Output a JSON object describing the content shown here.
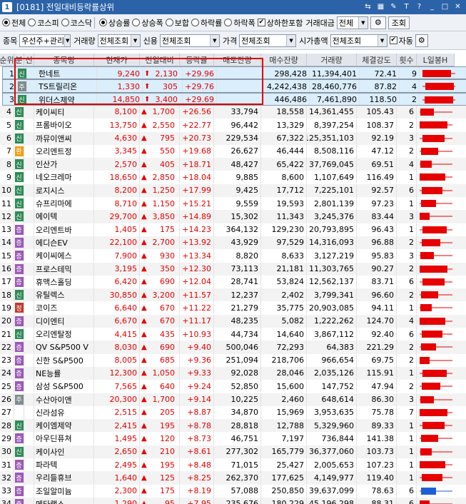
{
  "window": {
    "screen_no": "[0181]",
    "title": "전일대비등락률상위",
    "badge": "1"
  },
  "market_radios": [
    {
      "label": "전체",
      "checked": true
    },
    {
      "label": "코스피",
      "checked": false
    },
    {
      "label": "코스닥",
      "checked": false
    }
  ],
  "sort_radios": [
    {
      "label": "상승률",
      "checked": true
    },
    {
      "label": "상승폭",
      "checked": false
    },
    {
      "label": "보합",
      "checked": false
    },
    {
      "label": "하락률",
      "checked": false
    },
    {
      "label": "하락폭",
      "checked": false
    }
  ],
  "limit_include": {
    "label": "상하한포함",
    "checked": true
  },
  "volume_label": "거래대금",
  "volume_value": "전체",
  "search_label": "조회",
  "filters": {
    "stock_label": "종목",
    "stock_value": "우선주+관리",
    "volume_label": "거래량",
    "volume_value": "전체조회",
    "credit_label": "신용",
    "credit_value": "전체조회",
    "price_label": "가격",
    "price_value": "전체조회",
    "cap_label": "시가총액",
    "cap_value": "전체조회",
    "auto_label": "자동",
    "auto_checked": true
  },
  "columns": [
    "순위",
    "분",
    "신",
    "종목명",
    "현재가",
    "전일대비",
    "등락률",
    "매도잔량",
    "매수잔량",
    "거래량",
    "체결강도",
    "횟수",
    "L일봉H"
  ],
  "badge_colors": {
    "신": "#2e8b57",
    "증": "#9b59b6",
    "환": "#f39c12",
    "주": "#7f8c8d",
    "정": "#c0392b"
  },
  "rows": [
    {
      "rank": "1",
      "b1": "신",
      "b2": "",
      "name": "한네트",
      "price": "9,240",
      "chg": "2,130",
      "rate": "+29.96",
      "sell": "",
      "buy": "298,428",
      "vol": "11,394,401",
      "str": "72.41",
      "cnt": "9",
      "up": "limit"
    },
    {
      "rank": "2",
      "b1": "주",
      "b2": "",
      "name": "TS트릴리온",
      "price": "1,330",
      "chg": "305",
      "rate": "+29.76",
      "sell": "",
      "buy": "4,242,438",
      "vol": "28,460,776",
      "str": "87.82",
      "cnt": "4",
      "up": "limit"
    },
    {
      "rank": "3",
      "b1": "신",
      "b2": "",
      "name": "위더스제약",
      "price": "14,850",
      "chg": "3,400",
      "rate": "+29.69",
      "sell": "",
      "buy": "446,486",
      "vol": "7,461,890",
      "str": "118.50",
      "cnt": "2",
      "up": "limit"
    },
    {
      "rank": "4",
      "b1": "신",
      "b2": "",
      "name": "케이씨티",
      "price": "8,100",
      "chg": "1,700",
      "rate": "+26.56",
      "sell": "33,794",
      "buy": "18,558",
      "vol": "14,361,455",
      "str": "105.43",
      "cnt": "6",
      "up": "up"
    },
    {
      "rank": "5",
      "b1": "신",
      "b2": "",
      "name": "프롬바이오",
      "price": "13,750",
      "chg": "2,550",
      "rate": "+22.77",
      "sell": "96,442",
      "buy": "13,329",
      "vol": "8,397,254",
      "str": "108.37",
      "cnt": "2",
      "up": "up"
    },
    {
      "rank": "6",
      "b1": "신",
      "b2": "",
      "name": "까뮤이앤씨",
      "price": "4,630",
      "chg": "795",
      "rate": "+20.73",
      "sell": "229,534",
      "buy": "67,322",
      "vol": "125,351,103",
      "str": "92.19",
      "cnt": "3",
      "up": "up"
    },
    {
      "rank": "7",
      "b1": "환",
      "b2": "",
      "name": "오리엔트정",
      "price": "3,345",
      "chg": "550",
      "rate": "+19.68",
      "sell": "26,627",
      "buy": "46,444",
      "vol": "8,508,116",
      "str": "47.12",
      "cnt": "2",
      "up": "up"
    },
    {
      "rank": "8",
      "b1": "신",
      "b2": "",
      "name": "인산가",
      "price": "2,570",
      "chg": "405",
      "rate": "+18.71",
      "sell": "48,427",
      "buy": "65,422",
      "vol": "37,769,045",
      "str": "69.51",
      "cnt": "4",
      "up": "up"
    },
    {
      "rank": "9",
      "b1": "신",
      "b2": "",
      "name": "네오크레마",
      "price": "18,650",
      "chg": "2,850",
      "rate": "+18.04",
      "sell": "9,885",
      "buy": "8,600",
      "vol": "1,107,649",
      "str": "116.49",
      "cnt": "1",
      "up": "up"
    },
    {
      "rank": "10",
      "b1": "신",
      "b2": "",
      "name": "로지시스",
      "price": "8,200",
      "chg": "1,250",
      "rate": "+17.99",
      "sell": "9,425",
      "buy": "17,712",
      "vol": "7,225,101",
      "str": "92.57",
      "cnt": "6",
      "up": "up"
    },
    {
      "rank": "11",
      "b1": "신",
      "b2": "",
      "name": "슈프리마에",
      "price": "8,710",
      "chg": "1,150",
      "rate": "+15.21",
      "sell": "9,559",
      "buy": "19,593",
      "vol": "2,801,139",
      "str": "97.23",
      "cnt": "1",
      "up": "up"
    },
    {
      "rank": "12",
      "b1": "신",
      "b2": "",
      "name": "에이텍",
      "price": "29,700",
      "chg": "3,850",
      "rate": "+14.89",
      "sell": "15,302",
      "buy": "11,343",
      "vol": "3,245,376",
      "str": "83.44",
      "cnt": "3",
      "up": "up"
    },
    {
      "rank": "13",
      "b1": "증",
      "b2": "",
      "name": "오리엔트바",
      "price": "1,405",
      "chg": "175",
      "rate": "+14.23",
      "sell": "364,132",
      "buy": "129,230",
      "vol": "20,793,895",
      "str": "96.43",
      "cnt": "1",
      "up": "up"
    },
    {
      "rank": "14",
      "b1": "증",
      "b2": "",
      "name": "에디슨EV",
      "price": "22,100",
      "chg": "2,700",
      "rate": "+13.92",
      "sell": "43,929",
      "buy": "97,529",
      "vol": "14,316,093",
      "str": "96.88",
      "cnt": "2",
      "up": "up"
    },
    {
      "rank": "15",
      "b1": "증",
      "b2": "",
      "name": "케이씨에스",
      "price": "7,900",
      "chg": "930",
      "rate": "+13.34",
      "sell": "8,820",
      "buy": "8,633",
      "vol": "3,127,219",
      "str": "95.83",
      "cnt": "3",
      "up": "up"
    },
    {
      "rank": "16",
      "b1": "증",
      "b2": "",
      "name": "프로스테믹",
      "price": "3,195",
      "chg": "350",
      "rate": "+12.30",
      "sell": "73,113",
      "buy": "21,181",
      "vol": "11,303,765",
      "str": "90.27",
      "cnt": "2",
      "up": "up"
    },
    {
      "rank": "17",
      "b1": "증",
      "b2": "",
      "name": "휴맥스홀딩",
      "price": "6,420",
      "chg": "690",
      "rate": "+12.04",
      "sell": "28,741",
      "buy": "53,824",
      "vol": "12,562,137",
      "str": "83.71",
      "cnt": "6",
      "up": "up"
    },
    {
      "rank": "18",
      "b1": "신",
      "b2": "",
      "name": "유틸렉스",
      "price": "30,850",
      "chg": "3,200",
      "rate": "+11.57",
      "sell": "12,237",
      "buy": "2,402",
      "vol": "3,799,341",
      "str": "96.60",
      "cnt": "2",
      "up": "up"
    },
    {
      "rank": "19",
      "b1": "정",
      "b2": "",
      "name": "코이즈",
      "price": "6,640",
      "chg": "670",
      "rate": "+11.22",
      "sell": "21,279",
      "buy": "35,775",
      "vol": "20,903,085",
      "str": "94.11",
      "cnt": "1",
      "up": "up"
    },
    {
      "rank": "20",
      "b1": "증",
      "b2": "",
      "name": "디이엔티",
      "price": "6,670",
      "chg": "670",
      "rate": "+11.17",
      "sell": "48,235",
      "buy": "5,082",
      "vol": "1,222,262",
      "str": "124.70",
      "cnt": "4",
      "up": "up"
    },
    {
      "rank": "21",
      "b1": "신",
      "b2": "",
      "name": "오리엔탈정",
      "price": "4,415",
      "chg": "435",
      "rate": "+10.93",
      "sell": "44,734",
      "buy": "14,640",
      "vol": "3,867,112",
      "str": "92.40",
      "cnt": "6",
      "up": "up"
    },
    {
      "rank": "22",
      "b1": "증",
      "b2": "",
      "name": "QV S&P500 V",
      "price": "8,030",
      "chg": "690",
      "rate": "+9.40",
      "sell": "500,046",
      "buy": "72,293",
      "vol": "64,383",
      "str": "221.29",
      "cnt": "2",
      "up": "up"
    },
    {
      "rank": "23",
      "b1": "증",
      "b2": "",
      "name": "신한 S&P500",
      "price": "8,005",
      "chg": "685",
      "rate": "+9.36",
      "sell": "251,094",
      "buy": "218,706",
      "vol": "966,654",
      "str": "69.75",
      "cnt": "2",
      "up": "up"
    },
    {
      "rank": "24",
      "b1": "증",
      "b2": "",
      "name": "NE능률",
      "price": "12,300",
      "chg": "1,050",
      "rate": "+9.33",
      "sell": "92,028",
      "buy": "28,046",
      "vol": "2,035,126",
      "str": "115.91",
      "cnt": "1",
      "up": "up"
    },
    {
      "rank": "25",
      "b1": "증",
      "b2": "",
      "name": "삼성 S&P500",
      "price": "7,565",
      "chg": "640",
      "rate": "+9.24",
      "sell": "52,850",
      "buy": "15,600",
      "vol": "147,752",
      "str": "47.94",
      "cnt": "2",
      "up": "up"
    },
    {
      "rank": "26",
      "b1": "주",
      "b2": "",
      "name": "수산아이앤",
      "price": "20,300",
      "chg": "1,700",
      "rate": "+9.14",
      "sell": "10,225",
      "buy": "2,460",
      "vol": "648,614",
      "str": "86.30",
      "cnt": "3",
      "up": "up"
    },
    {
      "rank": "27",
      "b1": "",
      "b2": "",
      "name": "신라섬유",
      "price": "2,515",
      "chg": "205",
      "rate": "+8.87",
      "sell": "34,870",
      "buy": "15,969",
      "vol": "3,953,635",
      "str": "75.78",
      "cnt": "7",
      "up": "up"
    },
    {
      "rank": "28",
      "b1": "신",
      "b2": "",
      "name": "케이엠제약",
      "price": "2,415",
      "chg": "195",
      "rate": "+8.78",
      "sell": "28,818",
      "buy": "12,788",
      "vol": "5,329,960",
      "str": "89.33",
      "cnt": "1",
      "up": "up"
    },
    {
      "rank": "29",
      "b1": "증",
      "b2": "",
      "name": "아우딘퓨쳐",
      "price": "1,495",
      "chg": "120",
      "rate": "+8.73",
      "sell": "46,751",
      "buy": "7,197",
      "vol": "736,844",
      "str": "141.38",
      "cnt": "1",
      "up": "up"
    },
    {
      "rank": "30",
      "b1": "신",
      "b2": "",
      "name": "케이사인",
      "price": "2,650",
      "chg": "210",
      "rate": "+8.61",
      "sell": "277,302",
      "buy": "165,779",
      "vol": "36,377,060",
      "str": "103.73",
      "cnt": "1",
      "up": "up"
    },
    {
      "rank": "31",
      "b1": "증",
      "b2": "",
      "name": "파라텍",
      "price": "2,495",
      "chg": "195",
      "rate": "+8.48",
      "sell": "71,015",
      "buy": "25,427",
      "vol": "2,005,653",
      "str": "107.23",
      "cnt": "1",
      "up": "up"
    },
    {
      "rank": "32",
      "b1": "증",
      "b2": "",
      "name": "우리들휴브",
      "price": "1,640",
      "chg": "125",
      "rate": "+8.25",
      "sell": "262,370",
      "buy": "177,625",
      "vol": "4,149,977",
      "str": "119.40",
      "cnt": "1",
      "up": "up"
    },
    {
      "rank": "33",
      "b1": "증",
      "b2": "",
      "name": "조일알미늄",
      "price": "2,300",
      "chg": "175",
      "rate": "+8.19",
      "sell": "57,088",
      "buy": "250,850",
      "vol": "39,637,099",
      "str": "78.63",
      "cnt": "6",
      "up": "up"
    },
    {
      "rank": "34",
      "b1": "증",
      "b2": "",
      "name": "메타랩스",
      "price": "1,290",
      "chg": "95",
      "rate": "+7.95",
      "sell": "235,676",
      "buy": "180,229",
      "vol": "45,196,298",
      "str": "88.31",
      "cnt": "6",
      "up": "up"
    }
  ],
  "colors": {
    "up": "#e60000",
    "candle_up": "#e60000",
    "candle_down": "#1f5fd6",
    "highlight": "#e00000"
  }
}
